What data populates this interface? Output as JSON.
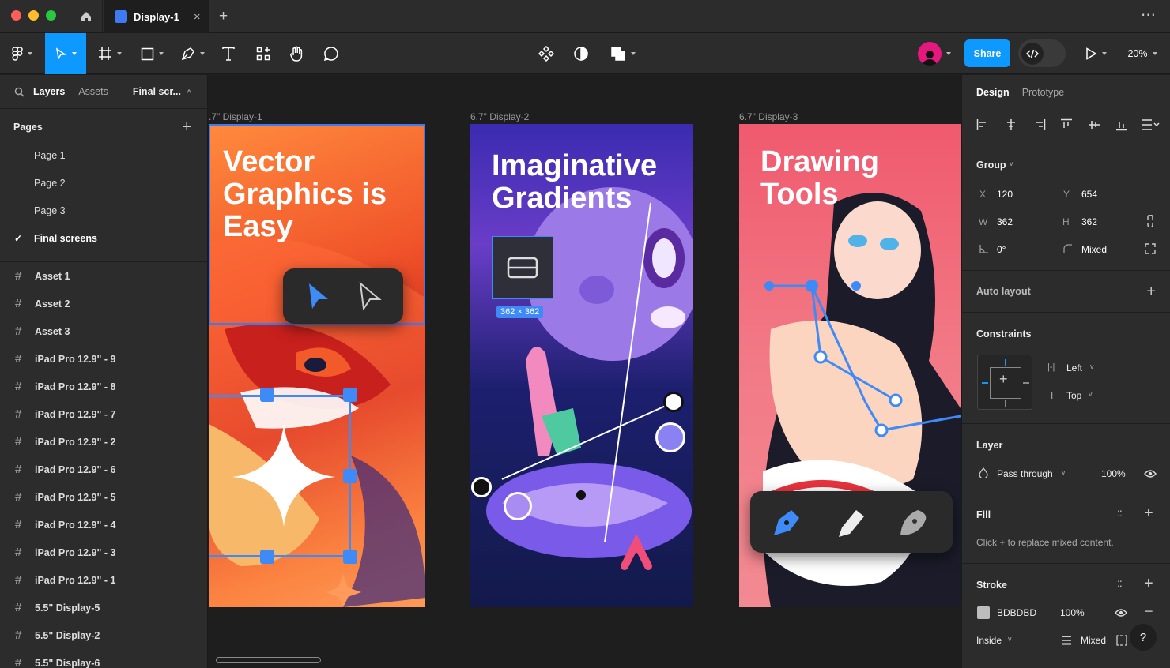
{
  "window": {
    "tab_title": "Display-1",
    "new_tab": "+",
    "more": "⋯"
  },
  "toolbar": {
    "share": "Share",
    "zoom": "20%"
  },
  "left": {
    "tabs": [
      "Layers",
      "Assets"
    ],
    "page_selector": "Final scr...",
    "pages_heading": "Pages",
    "add_page": "+",
    "pages": [
      "Page 1",
      "Page 2",
      "Page 3",
      "Final screens"
    ],
    "checkmark": "✓",
    "layers": [
      "Asset 1",
      "Asset 2",
      "Asset 3",
      "iPad Pro 12.9\" - 9",
      "iPad Pro 12.9\" - 8",
      "iPad Pro 12.9\" - 7",
      "iPad Pro 12.9\" - 2",
      "iPad Pro 12.9\" - 6",
      "iPad Pro 12.9\" - 5",
      "iPad Pro 12.9\" - 4",
      "iPad Pro 12.9\" - 3",
      "iPad Pro 12.9\" - 1",
      "5.5\" Display-5",
      "5.5\" Display-2",
      "5.5\" Display-6"
    ],
    "hash": "#"
  },
  "canvas": {
    "frames": [
      {
        "label": ".7\" Display-1",
        "title": "Vector Graphics is Easy"
      },
      {
        "label": "6.7\" Display-2",
        "title": "Imaginative Gradients"
      },
      {
        "label": "6.7\" Display-3",
        "title": "Drawing Tools"
      }
    ],
    "size_badge": "362 × 362"
  },
  "right": {
    "tabs": [
      "Design",
      "Prototype"
    ],
    "group": {
      "label": "Group",
      "x_label": "X",
      "x": "120",
      "y_label": "Y",
      "y": "654",
      "w_label": "W",
      "w": "362",
      "h_label": "H",
      "h": "362",
      "rotation": "0°",
      "radius": "Mixed"
    },
    "auto_layout": "Auto layout",
    "constraints": {
      "label": "Constraints",
      "h": "Left",
      "v": "Top"
    },
    "layer": {
      "label": "Layer",
      "blend": "Pass through",
      "opacity": "100%"
    },
    "fill": {
      "label": "Fill",
      "hint": "Click + to replace mixed content."
    },
    "stroke": {
      "label": "Stroke",
      "color": "BDBDBD",
      "opacity": "100%",
      "position": "Inside",
      "weight": "Mixed"
    },
    "help": "?"
  },
  "colors": {
    "accent": "#0d99ff",
    "share": "#0d99ff",
    "panel": "#2c2c2c",
    "canvas": "#1e1e1e"
  }
}
